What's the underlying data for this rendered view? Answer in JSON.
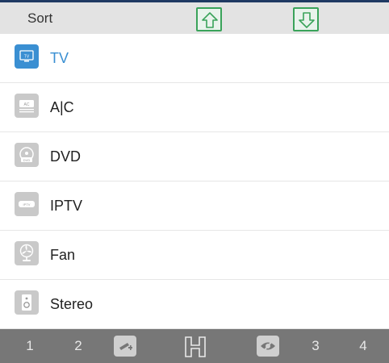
{
  "header": {
    "title": "Sort"
  },
  "devices": [
    {
      "label": "TV",
      "icon": "tv-icon",
      "badge": "TV"
    },
    {
      "label": "A|C",
      "icon": "ac-icon",
      "badge": "AC"
    },
    {
      "label": "DVD",
      "icon": "dvd-icon",
      "badge": "DVD"
    },
    {
      "label": "IPTV",
      "icon": "iptv-icon",
      "badge": "IPTV"
    },
    {
      "label": "Fan",
      "icon": "fan-icon"
    },
    {
      "label": "Stereo",
      "icon": "speaker-icon"
    }
  ],
  "bottom_bar": {
    "n1": "1",
    "n2": "2",
    "n3": "3",
    "n4": "4"
  },
  "colors": {
    "accent": "#3a8fd2",
    "arrow": "#3aa35a",
    "bar": "#777777",
    "header": "#e3e3e3"
  }
}
